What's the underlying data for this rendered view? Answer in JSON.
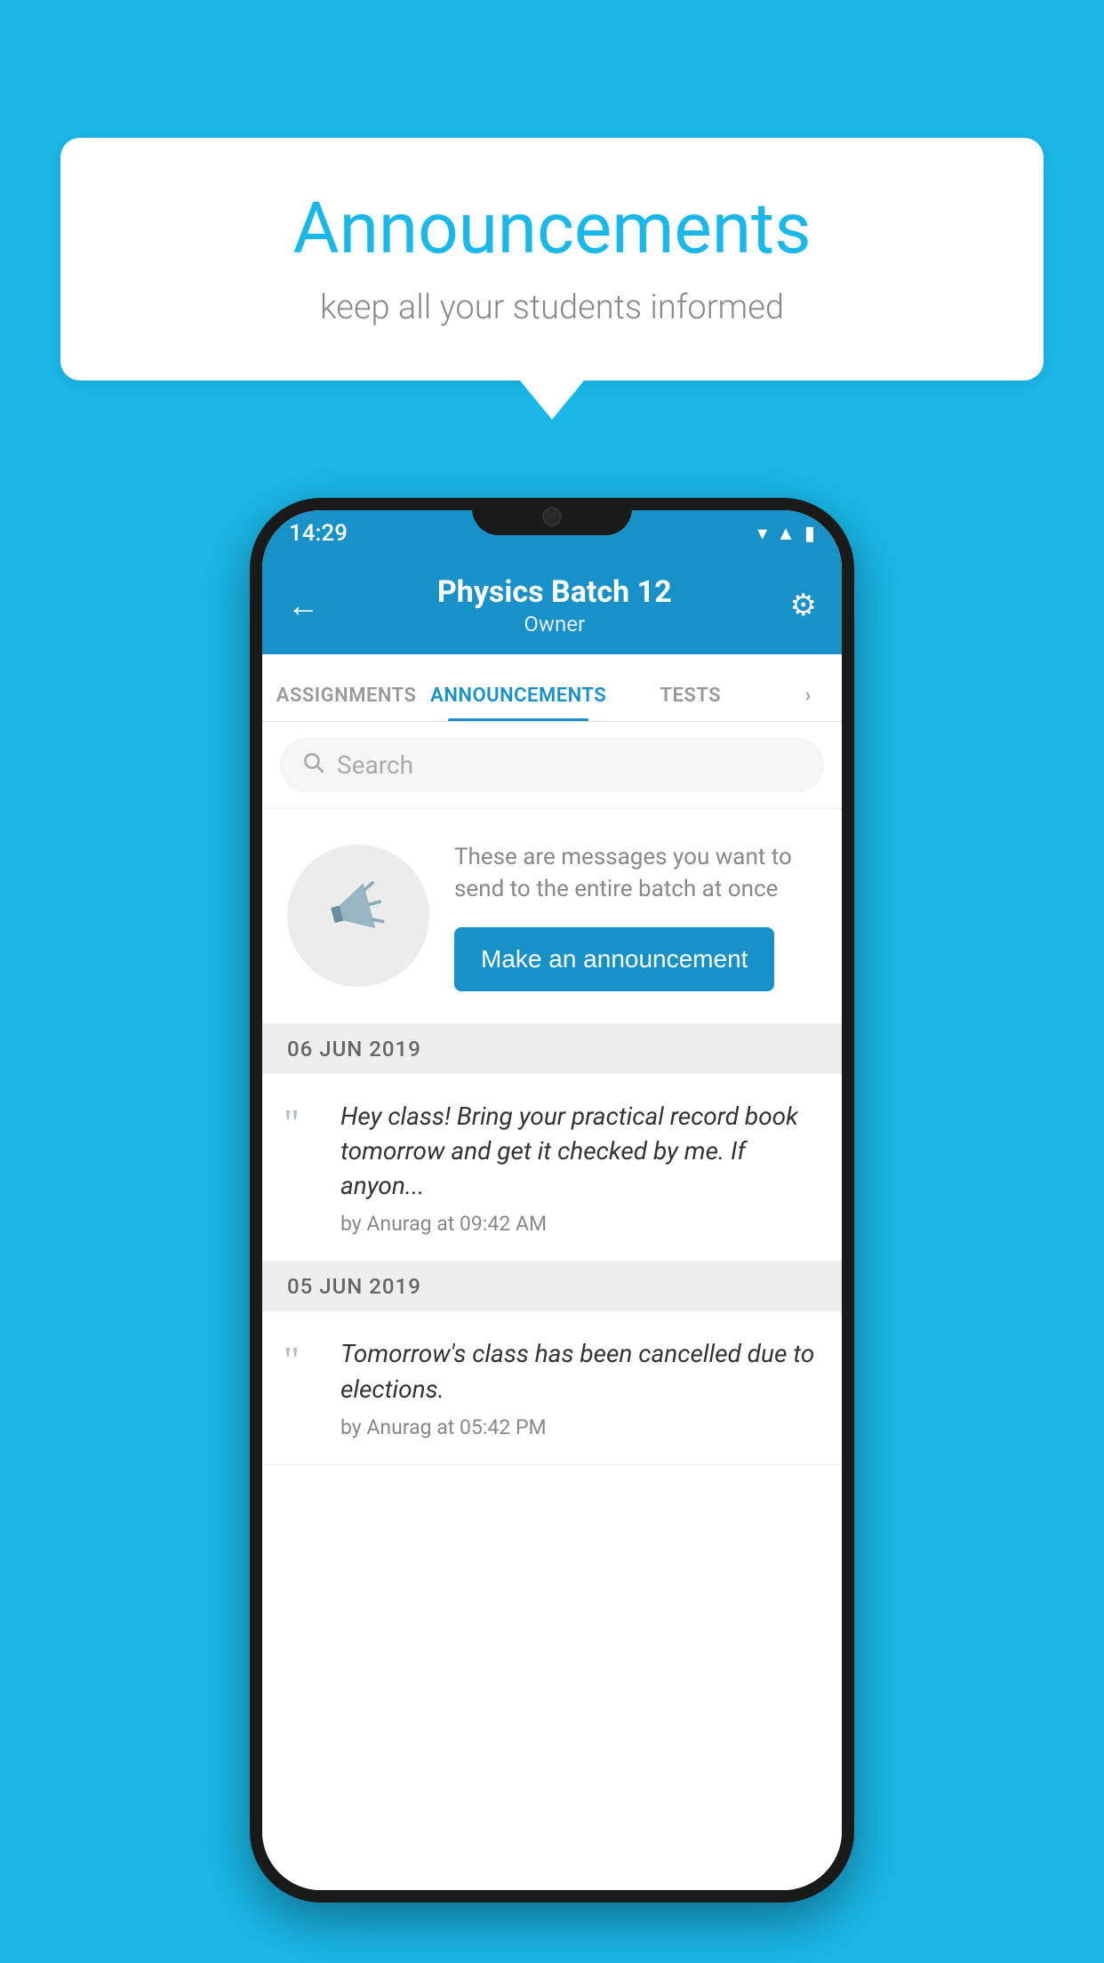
{
  "background_color": "#1ab8e8",
  "bubble": {
    "title": "Announcements",
    "subtitle": "keep all your students informed"
  },
  "phone": {
    "status_bar": {
      "time": "14:29"
    },
    "app_bar": {
      "title": "Physics Batch 12",
      "subtitle": "Owner",
      "back_label": "←",
      "settings_label": "⚙"
    },
    "tabs": [
      {
        "label": "ASSIGNMENTS",
        "active": false
      },
      {
        "label": "ANNOUNCEMENTS",
        "active": true
      },
      {
        "label": "TESTS",
        "active": false
      },
      {
        "label": "›",
        "active": false
      }
    ],
    "search": {
      "placeholder": "Search"
    },
    "empty_state": {
      "description": "These are messages you want to send to the entire batch at once",
      "button_label": "Make an announcement"
    },
    "announcements": [
      {
        "date": "06  JUN  2019",
        "items": [
          {
            "text": "Hey class! Bring your practical record book tomorrow and get it checked by me. If anyon...",
            "meta": "by Anurag at 09:42 AM"
          }
        ]
      },
      {
        "date": "05  JUN  2019",
        "items": [
          {
            "text": "Tomorrow's class has been cancelled due to elections.",
            "meta": "by Anurag at 05:42 PM"
          }
        ]
      }
    ]
  }
}
